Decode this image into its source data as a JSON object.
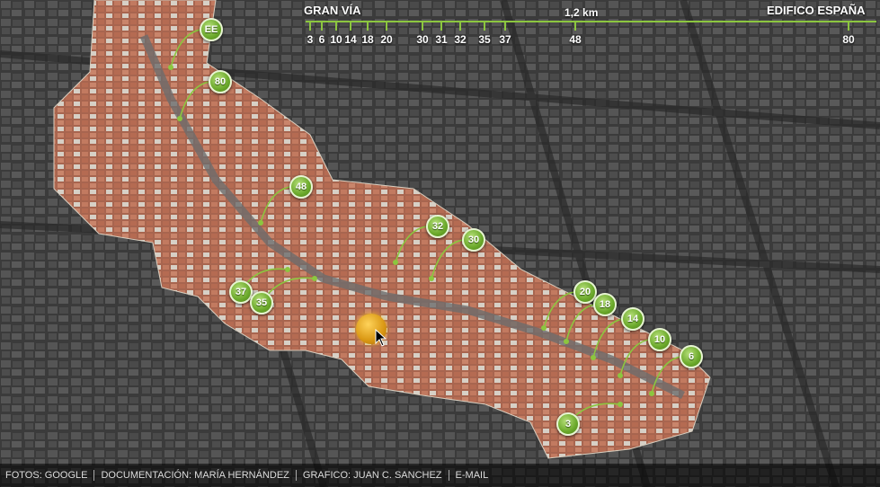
{
  "scale": {
    "start_label": "GRAN VÍA",
    "distance_label": "1,2 km",
    "end_label": "EDIFICO ESPAÑA",
    "ticks": [
      "3",
      "6",
      "10",
      "14",
      "18",
      "20",
      "30",
      "31",
      "32",
      "35",
      "37",
      "48",
      "80"
    ]
  },
  "markers": [
    {
      "id": "EE",
      "label": "EE"
    },
    {
      "id": "80",
      "label": "80"
    },
    {
      "id": "48",
      "label": "48"
    },
    {
      "id": "32",
      "label": "32"
    },
    {
      "id": "30",
      "label": "30"
    },
    {
      "id": "37",
      "label": "37"
    },
    {
      "id": "35",
      "label": "35"
    },
    {
      "id": "20",
      "label": "20"
    },
    {
      "id": "18",
      "label": "18"
    },
    {
      "id": "14",
      "label": "14"
    },
    {
      "id": "10",
      "label": "10"
    },
    {
      "id": "6",
      "label": "6"
    },
    {
      "id": "3",
      "label": "3"
    }
  ],
  "footer": {
    "photos": "FOTOS: GOOGLE",
    "documentation": "DOCUMENTACIÓN:  MARÍA HERNÁNDEZ",
    "graphic": "GRAFICO: JUAN C. SANCHEZ",
    "email": "E-MAIL"
  },
  "colors": {
    "accent": "#8cc63f",
    "highlight_area": "#b8715a",
    "background_city": "#3d3d3d"
  }
}
